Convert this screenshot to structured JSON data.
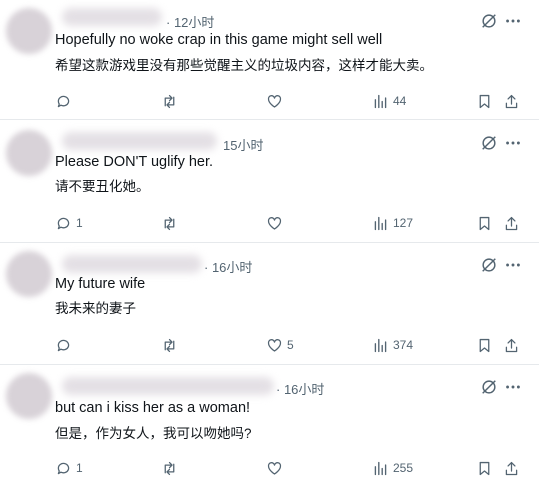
{
  "posts": [
    {
      "time": "· 12小时",
      "text_en": "Hopefully no woke crap in this game might sell well",
      "text_zh": "希望这款游戏里没有那些觉醒主义的垃圾内容，这样才能大卖。",
      "replies": "",
      "likes": "",
      "views": "44"
    },
    {
      "time": "15小时",
      "text_en": "Please DON'T uglify her.",
      "text_zh": "请不要丑化她。",
      "replies": "1",
      "likes": "",
      "views": "127"
    },
    {
      "time": "· 16小时",
      "text_en": "My future wife",
      "text_zh": "我未来的妻子",
      "replies": "",
      "likes": "5",
      "views": "374"
    },
    {
      "time": "· 16小时",
      "text_en": "but can i kiss her as a woman!",
      "text_zh": "但是，作为女人，我可以吻她吗?",
      "replies": "1",
      "likes": "",
      "views": "255"
    }
  ],
  "icons": {
    "reply": "reply-icon",
    "repost": "repost-icon",
    "like": "like-icon",
    "views": "views-icon",
    "bookmark": "bookmark-icon",
    "share": "share-icon",
    "grok": "grok-icon",
    "more": "more-icon"
  },
  "colors": {
    "text": "#0f1419",
    "muted": "#536471",
    "divider": "#e6e9ec"
  }
}
